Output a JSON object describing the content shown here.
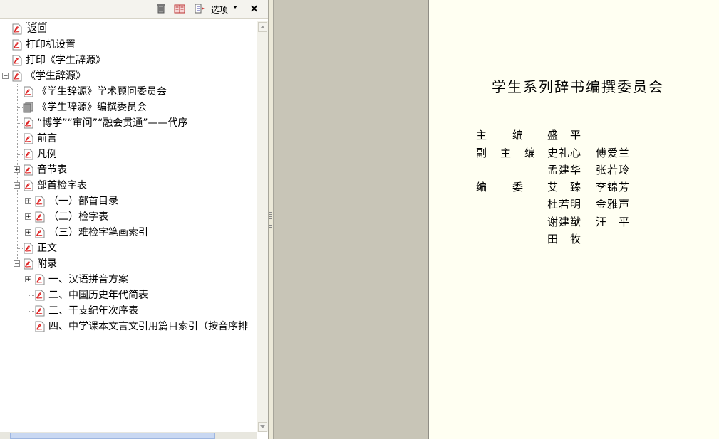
{
  "toolbar": {
    "options_label": "选项",
    "close_label": "×",
    "delete_icon": "trash-icon",
    "expand_icon": "book-icon",
    "options_icon": "bookmark-options-icon"
  },
  "bookmarks": [
    {
      "label": "返回"
    },
    {
      "label": "打印机设置"
    },
    {
      "label": "打印《学生辞源》"
    },
    {
      "label": "《学生辞源》"
    },
    {
      "label": "《学生辞源》学术顾问委员会"
    },
    {
      "label": "《学生辞源》编撰委员会"
    },
    {
      "label": "“博学”“审问”“融会贯通”——代序"
    },
    {
      "label": "前言"
    },
    {
      "label": "凡例"
    },
    {
      "label": "音节表"
    },
    {
      "label": "部首检字表"
    },
    {
      "label": "（一）部首目录"
    },
    {
      "label": "（二）检字表"
    },
    {
      "label": "（三）难检字笔画索引"
    },
    {
      "label": "正文"
    },
    {
      "label": "附录"
    },
    {
      "label": "一、汉语拼音方案"
    },
    {
      "label": "二、中国历史年代简表"
    },
    {
      "label": "三、干支纪年次序表"
    },
    {
      "label": "四、中学课本文言文引用篇目索引（按音序排"
    }
  ],
  "document": {
    "title": "学生系列辞书编撰委员会",
    "roles": {
      "chief": "主　　编",
      "deputy": "副　主　编",
      "editors": "编　　委"
    },
    "names": {
      "chief": "盛　平",
      "deputy_1": "史礼心",
      "deputy_2": "傅爱兰",
      "deputy_3": "孟建华",
      "deputy_4": "张若玲",
      "editor_1": "艾　臻",
      "editor_2": "李锦芳",
      "editor_3": "杜若明",
      "editor_4": "金雅声",
      "editor_5": "谢建猷",
      "editor_6": "汪　平",
      "editor_7": "田　牧"
    }
  }
}
